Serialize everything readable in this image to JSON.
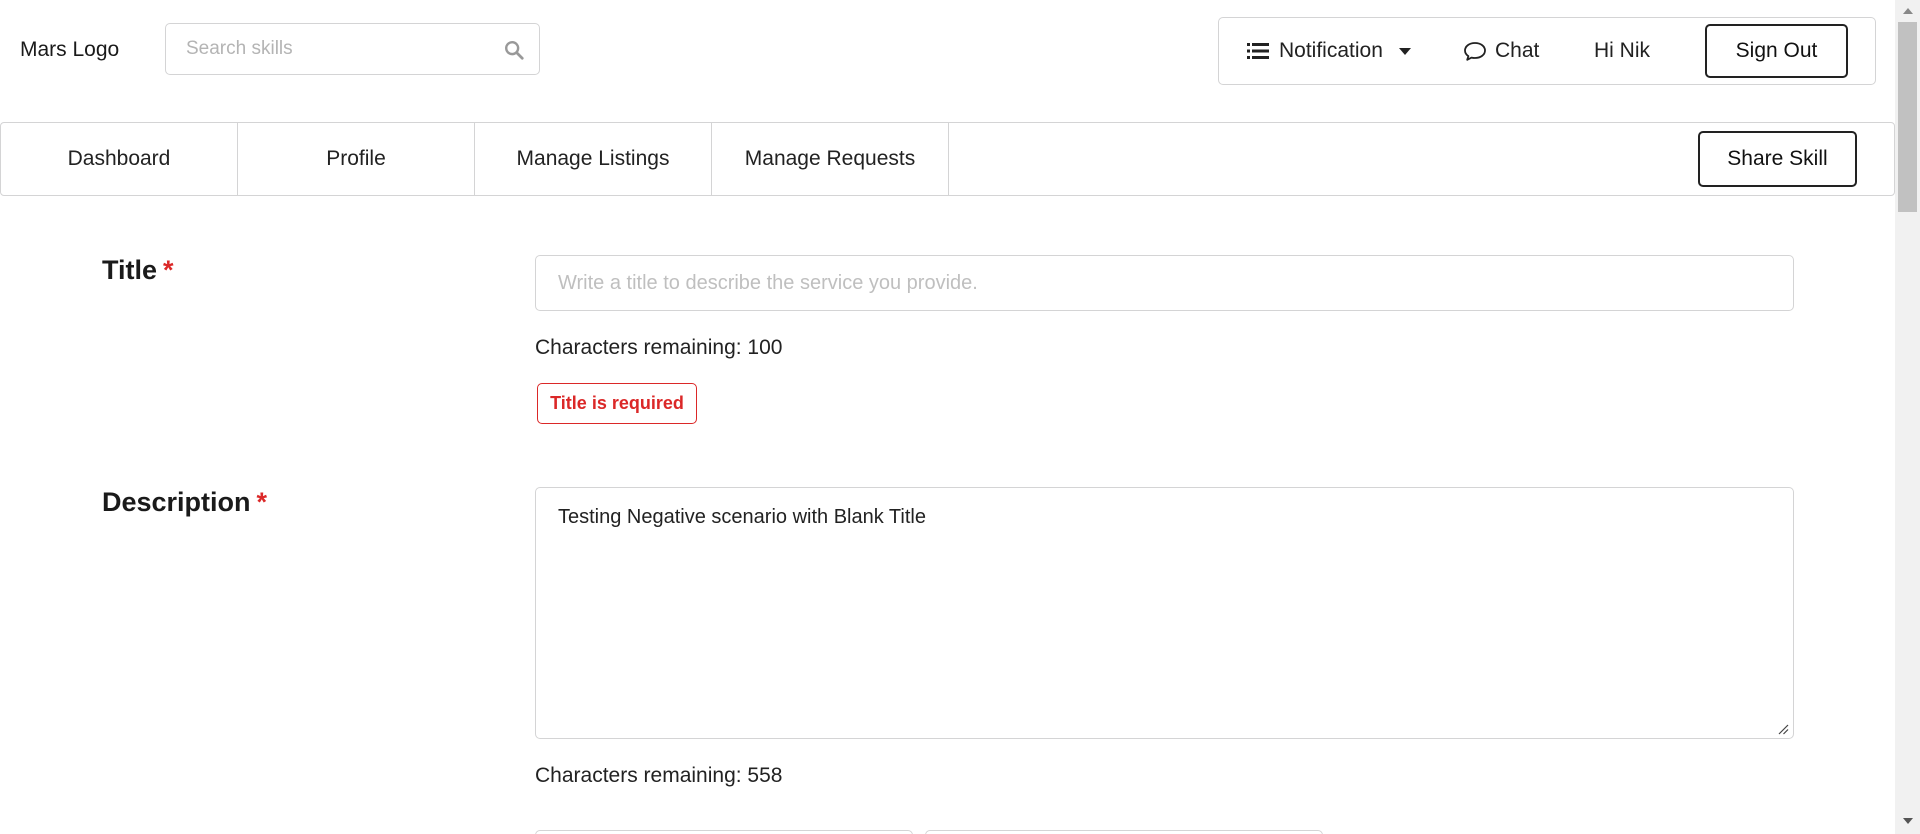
{
  "header": {
    "logo": "Mars Logo",
    "search_placeholder": "Search skills",
    "search_icon": "search-icon",
    "notification_label": "Notification",
    "notification_icon": "list-icon",
    "chat_label": "Chat",
    "chat_icon": "chat-bubble-icon",
    "greeting": "Hi Nik",
    "signout_label": "Sign Out"
  },
  "nav": {
    "items": [
      {
        "label": "Dashboard"
      },
      {
        "label": "Profile"
      },
      {
        "label": "Manage Listings"
      },
      {
        "label": "Manage Requests"
      }
    ],
    "share_label": "Share Skill"
  },
  "form": {
    "title_label": "Title",
    "required_mark": "*",
    "title_value": "",
    "title_placeholder": "Write a title to describe the service you provide.",
    "title_remaining": "Characters remaining: 100",
    "title_error": "Title is required",
    "description_label": "Description",
    "description_value": "Testing Negative scenario with Blank Title",
    "description_remaining": "Characters remaining: 558"
  },
  "colors": {
    "error": "#db2828",
    "border": "#d4d4d5",
    "text": "#222222"
  }
}
